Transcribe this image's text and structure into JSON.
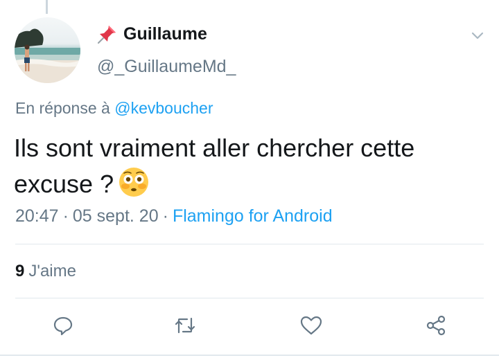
{
  "tweet": {
    "author": {
      "display_name": "Guillaume",
      "handle": "@_GuillaumeMd_",
      "pin_emoji": "📌"
    },
    "reply_to": {
      "prefix": "En réponse à",
      "mention": "@kevboucher"
    },
    "text": "Ils sont vraiment aller chercher cette excuse ?",
    "emoji_name": "flushed-face",
    "time": "20:47",
    "date": "05 sept. 20",
    "separator": "·",
    "client": "Flamingo for Android",
    "likes": {
      "count": "9",
      "label": "J'aime"
    },
    "actions": [
      "reply-icon",
      "retweet-icon",
      "like-icon",
      "share-icon"
    ]
  },
  "colors": {
    "text": "#14171a",
    "secondary": "#657786",
    "accent": "#1da1f2",
    "divider": "#e1e8ed"
  }
}
